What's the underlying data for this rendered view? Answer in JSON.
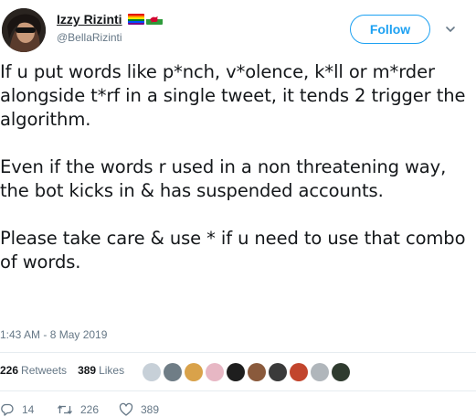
{
  "user": {
    "display_name": "Izzy Rizinti",
    "handle": "@BellaRizinti",
    "flags": [
      "rainbow-flag-icon",
      "wales-flag-icon"
    ]
  },
  "follow_label": "Follow",
  "tweet": {
    "paragraphs": [
      "If u put words like p*nch, v*olence, k*ll or m*rder alongside t*rf in a single tweet, it tends 2 trigger the algorithm.",
      "Even if the words r used in a non threatening way, the bot kicks in & has suspended accounts.",
      "Please take care & use * if u need to use that combo of words."
    ],
    "timestamp": "1:43 AM - 8 May 2019"
  },
  "stats": {
    "retweets_count": "226",
    "retweets_label": "Retweets",
    "likes_count": "389",
    "likes_label": "Likes"
  },
  "actions": {
    "reply_count": "14",
    "retweet_count": "226",
    "like_count": "389"
  },
  "colors": {
    "accent": "#1da1f2",
    "muted": "#657786",
    "text": "#14171a",
    "divider": "#e6ecf0"
  }
}
